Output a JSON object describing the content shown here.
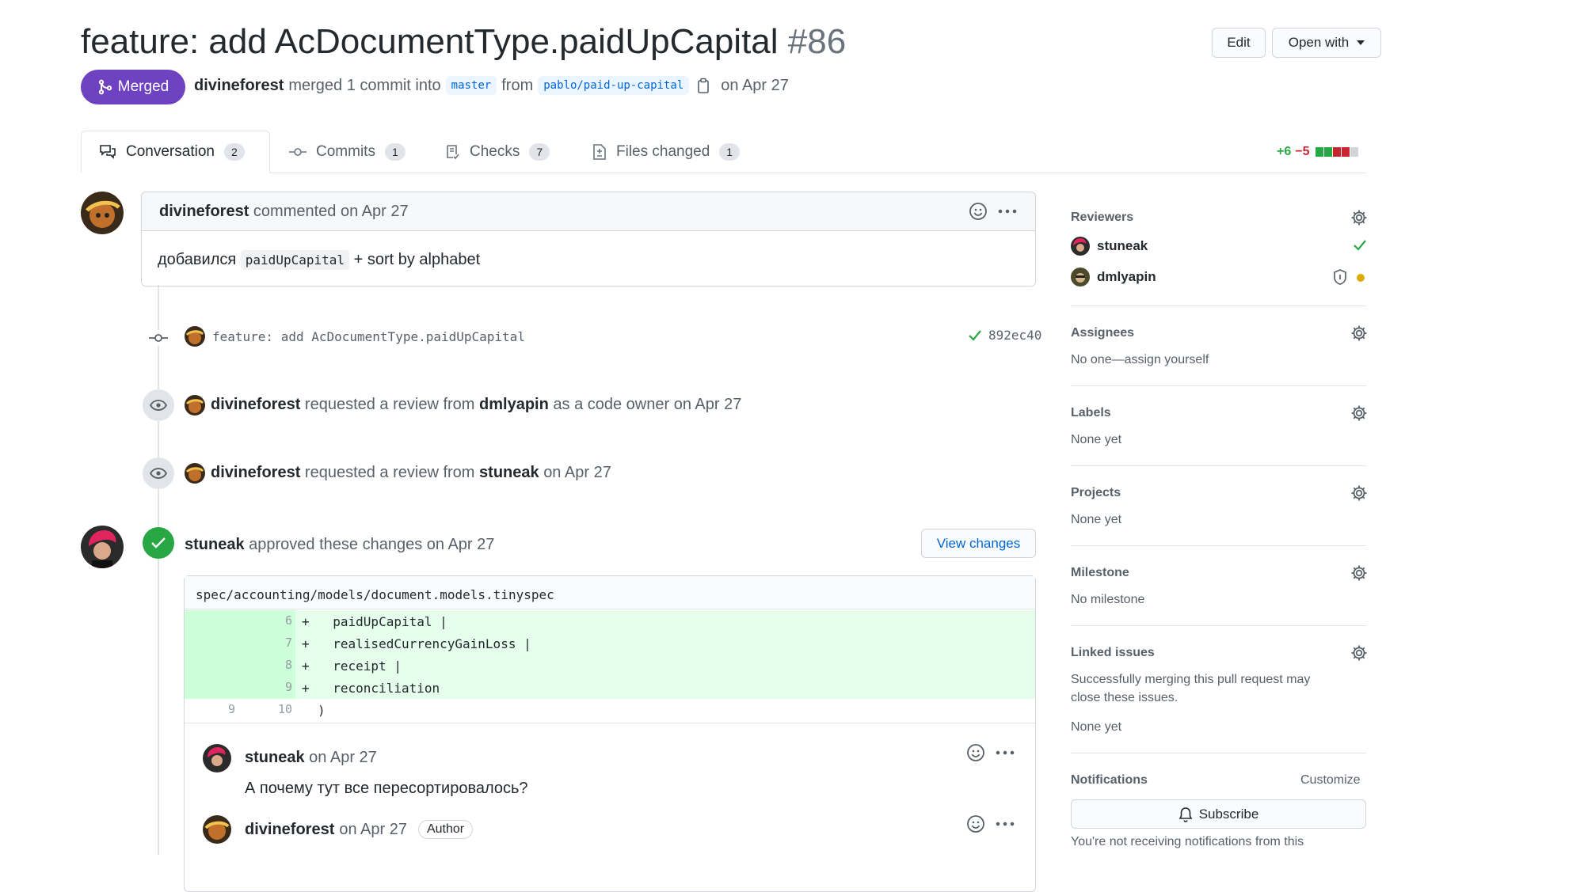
{
  "pr": {
    "title": "feature: add AcDocumentType.paidUpCapital",
    "number": "#86",
    "state_label": "Merged",
    "author": "divineforest",
    "merge_text": "merged 1 commit into",
    "base_branch": "master",
    "from_text": "from",
    "head_branch": "pablo/paid-up-capital",
    "date_text": "on Apr 27"
  },
  "header_buttons": {
    "edit": "Edit",
    "open_with": "Open with"
  },
  "tabs": [
    {
      "label": "Conversation",
      "count": "2"
    },
    {
      "label": "Commits",
      "count": "1"
    },
    {
      "label": "Checks",
      "count": "7"
    },
    {
      "label": "Files changed",
      "count": "1"
    }
  ],
  "diffstat": {
    "additions": "+6",
    "deletions": "−5"
  },
  "comment": {
    "author": "divineforest",
    "meta": "commented on Apr 27",
    "body_prefix": "добавился",
    "body_code": "paidUpCapital",
    "body_suffix": "+ sort by alphabet"
  },
  "commit": {
    "message": "feature: add AcDocumentType.paidUpCapital",
    "sha": "892ec40"
  },
  "events": [
    {
      "actor": "divineforest",
      "t1": "requested a review from",
      "target": "dmlyapin",
      "t2": "as a code owner on Apr 27"
    },
    {
      "actor": "divineforest",
      "t1": "requested a review from",
      "target": "stuneak",
      "t2": "on Apr 27"
    }
  ],
  "approval": {
    "actor": "stuneak",
    "text": "approved these changes on Apr 27",
    "view_changes": "View changes"
  },
  "diff": {
    "file": "spec/accounting/models/document.models.tinyspec",
    "lines": [
      {
        "old": "",
        "new": "6",
        "sign": "+",
        "code": "  paidUpCapital |"
      },
      {
        "old": "",
        "new": "7",
        "sign": "+",
        "code": "  realisedCurrencyGainLoss |"
      },
      {
        "old": "",
        "new": "8",
        "sign": "+",
        "code": "  receipt |"
      },
      {
        "old": "",
        "new": "9",
        "sign": "+",
        "code": "  reconciliation"
      },
      {
        "old": "9",
        "new": "10",
        "sign": "",
        "code": ")"
      }
    ]
  },
  "review_comments": [
    {
      "author": "stuneak",
      "date": "on Apr 27",
      "body": "А почему тут все пересортировалось?"
    },
    {
      "author": "divineforest",
      "date": "on Apr 27",
      "badge": "Author"
    }
  ],
  "sidebar": {
    "reviewers": {
      "title": "Reviewers",
      "people": [
        "stuneak",
        "dmlyapin"
      ]
    },
    "assignees": {
      "title": "Assignees",
      "value": "No one—assign yourself"
    },
    "labels": {
      "title": "Labels",
      "value": "None yet"
    },
    "projects": {
      "title": "Projects",
      "value": "None yet"
    },
    "milestone": {
      "title": "Milestone",
      "value": "No milestone"
    },
    "linked_issues": {
      "title": "Linked issues",
      "line1": "Successfully merging this pull request may",
      "line2": "close these issues.",
      "value": "None yet"
    },
    "notifications": {
      "title": "Notifications",
      "customize": "Customize",
      "subscribe": "Subscribe",
      "footer": "You're not receiving notifications from this"
    }
  },
  "colors": {
    "merged": "#6f42c1",
    "link": "#0366d6",
    "success": "#28a745",
    "danger": "#cb2431",
    "pending": "#dbab09"
  }
}
